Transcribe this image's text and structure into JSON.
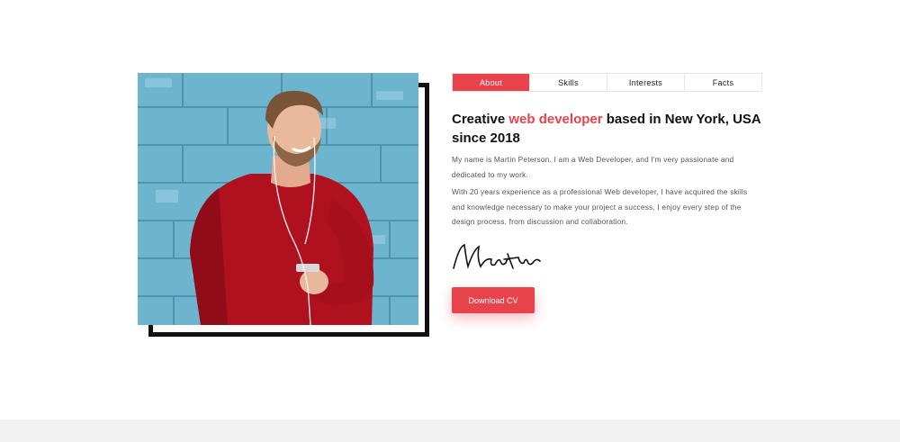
{
  "tabs": [
    "About",
    "Skills",
    "Interests",
    "Facts"
  ],
  "headline": {
    "before": "Creative ",
    "accent": "web developer",
    "after": " based in New York, USA since 2018"
  },
  "paragraphs": [
    "My name is Martin Peterson. I am a Web Developer, and I'm very passionate and dedicated to my work.",
    "With 20 years experience as a professional Web developer, I have acquired the skills and knowledge necessary to make your project a success. I enjoy every step of the design process, from discussion and collaboration."
  ],
  "signature": "Martin",
  "download_button": "Download CV",
  "colors": {
    "accent": "#e8434a",
    "frame": "#111111",
    "footer": "#f1f1f1"
  }
}
